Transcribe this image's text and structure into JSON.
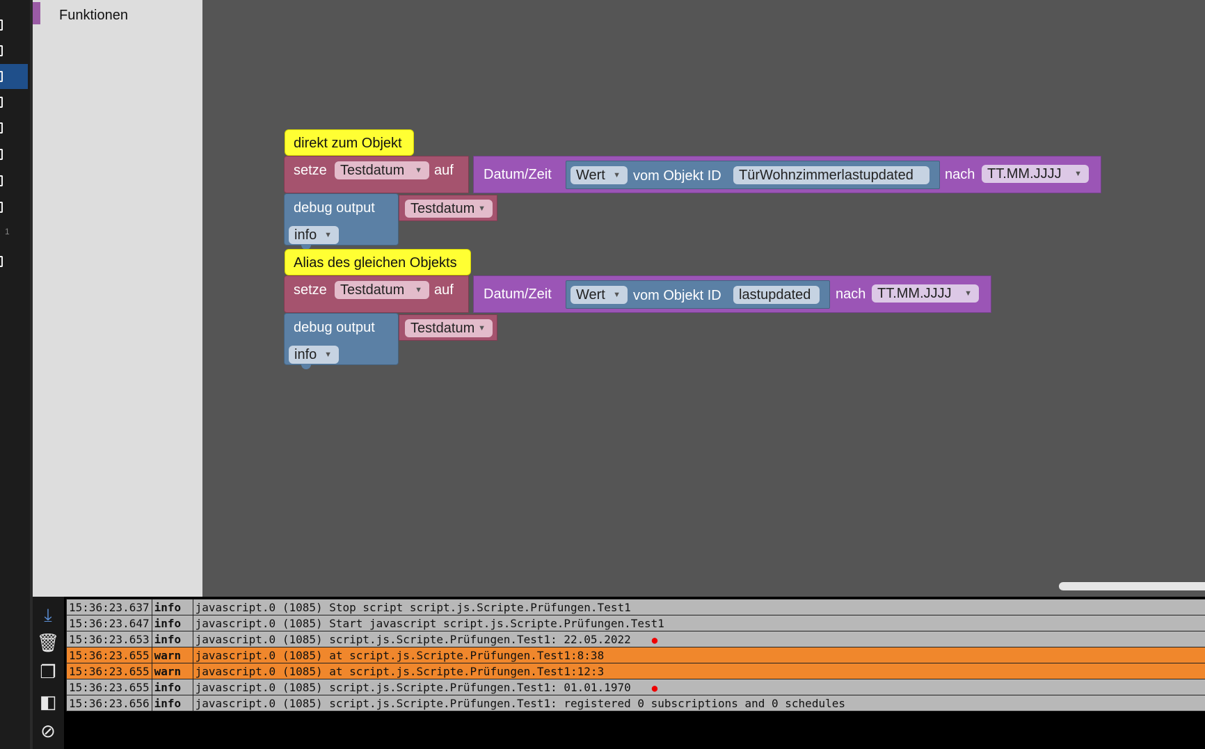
{
  "sidebar": {
    "badge_count": "1"
  },
  "toolbox": {
    "category_label": "Funktionen",
    "category_color": "#9a5ba5"
  },
  "workspace": {
    "groups": [
      {
        "comment": "direkt zum Objekt",
        "set_label": "setze",
        "set_variable": "Testdatum",
        "set_to_label": "auf",
        "datetime_label": "Datum/Zeit",
        "value_dropdown": "Wert",
        "object_label": "vom Objekt ID",
        "object_id": "TürWohnzimmerlastupdated",
        "format_label": "nach",
        "format_value": "TT.MM.JJJJ",
        "debug_label": "debug output",
        "debug_variable": "Testdatum",
        "log_level": "info"
      },
      {
        "comment": "Alias des gleichen Objekts",
        "set_label": "setze",
        "set_variable": "Testdatum",
        "set_to_label": "auf",
        "datetime_label": "Datum/Zeit",
        "value_dropdown": "Wert",
        "object_label": "vom Objekt ID",
        "object_id": "lastupdated",
        "format_label": "nach",
        "format_value": "TT.MM.JJJJ",
        "debug_label": "debug output",
        "debug_variable": "Testdatum",
        "log_level": "info"
      }
    ]
  },
  "log": {
    "toolbar_icons": [
      "scroll-down-icon",
      "trash-icon",
      "copy-icon",
      "columns-icon",
      "hide-icon"
    ],
    "rows": [
      {
        "time": "15:36:23.637",
        "severity": "info",
        "message": "javascript.0 (1085) Stop script script.js.Scripte.Prüfungen.Test1",
        "marker": ""
      },
      {
        "time": "15:36:23.647",
        "severity": "info",
        "message": "javascript.0 (1085) Start javascript script.js.Scripte.Prüfungen.Test1",
        "marker": ""
      },
      {
        "time": "15:36:23.653",
        "severity": "info",
        "message": "javascript.0 (1085) script.js.Scripte.Prüfungen.Test1: 22.05.2022",
        "marker": "●"
      },
      {
        "time": "15:36:23.655",
        "severity": "warn",
        "message": "javascript.0 (1085) at script.js.Scripte.Prüfungen.Test1:8:38",
        "marker": ""
      },
      {
        "time": "15:36:23.655",
        "severity": "warn",
        "message": "javascript.0 (1085) at script.js.Scripte.Prüfungen.Test1:12:3",
        "marker": ""
      },
      {
        "time": "15:36:23.655",
        "severity": "info",
        "message": "javascript.0 (1085) script.js.Scripte.Prüfungen.Test1: 01.01.1970",
        "marker": "●"
      },
      {
        "time": "15:36:23.656",
        "severity": "info",
        "message": "javascript.0 (1085) script.js.Scripte.Prüfungen.Test1: registered 0 subscriptions and 0 schedules",
        "marker": ""
      }
    ]
  }
}
